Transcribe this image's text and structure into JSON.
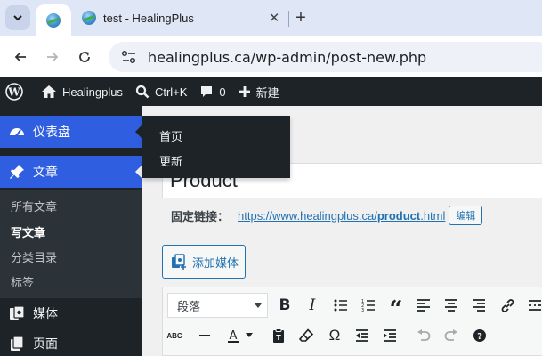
{
  "browser": {
    "tabs": [
      {
        "title": "",
        "active": true
      },
      {
        "title": "test - HealingPlus",
        "active": false
      }
    ],
    "url": "healingplus.ca/wp-admin/post-new.php",
    "close_glyph": "✕",
    "newtab_glyph": "+"
  },
  "adminbar": {
    "site_name": "Healingplus",
    "search_shortcut": "Ctrl+K",
    "comments_count": "0",
    "new_label": "新建"
  },
  "sidebar": {
    "dashboard": "仪表盘",
    "posts": "文章",
    "posts_submenu": [
      "所有文章",
      "写文章",
      "分类目录",
      "标签"
    ],
    "media": "媒体",
    "pages": "页面"
  },
  "flyout": {
    "items": [
      "首页",
      "更新"
    ]
  },
  "editor": {
    "title_value": "Product",
    "permalink_label": "固定链接：",
    "permalink_prefix": "https://www.healingplus.ca/",
    "permalink_slug": "product",
    "permalink_suffix": ".html",
    "edit_button": "编辑",
    "add_media_button": "添加媒体",
    "format_select": "段落"
  },
  "colors": {
    "admin_dark": "#1d2327",
    "wp_blue": "#2271b1",
    "dash_highlight": "#2f5fe0"
  }
}
